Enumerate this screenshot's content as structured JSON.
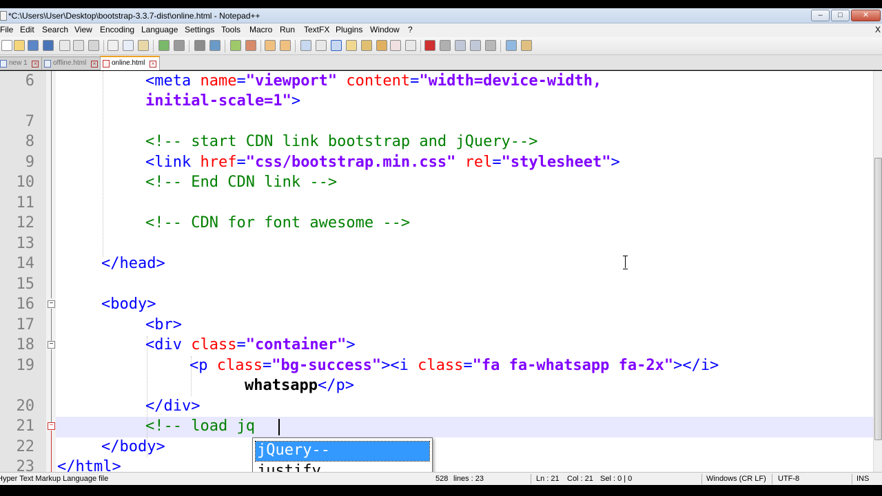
{
  "window": {
    "title": "*C:\\Users\\User\\Desktop\\bootstrap-3.3.7-dist\\online.html - Notepad++",
    "buttons": [
      "–",
      "□",
      "✕"
    ]
  },
  "menubar": {
    "items": [
      "File",
      "Edit",
      "Search",
      "View",
      "Encoding",
      "Language",
      "Settings",
      "Tools",
      "Macro",
      "Run",
      "TextFX",
      "Plugins",
      "Window",
      "?"
    ],
    "close_label": "X"
  },
  "tabs": [
    {
      "label": "new 1",
      "active": false
    },
    {
      "label": "offline.html",
      "active": false
    },
    {
      "label": "online.html",
      "active": true
    }
  ],
  "editor": {
    "line_numbers": [
      "6",
      "7",
      "8",
      "9",
      "10",
      "11",
      "12",
      "13",
      "14",
      "15",
      "16",
      "17",
      "18",
      "19",
      "20",
      "21",
      "22",
      "23"
    ],
    "lines": [
      [
        "<meta",
        " name",
        "=",
        "\"viewport\"",
        " content",
        "=",
        "\"width=device-width,"
      ],
      [
        "initial-scale=1\"",
        ">"
      ],
      [
        "<!-- start CDN link bootstrap and jQuery-->"
      ],
      [
        "<link",
        " href",
        "=",
        "\"css/bootstrap.min.css\"",
        " rel",
        "=",
        "\"stylesheet\"",
        ">"
      ],
      [
        "<!-- End CDN link -->"
      ],
      [
        "<!-- CDN for font awesome -->"
      ],
      [
        "</head>"
      ],
      [
        "<body>"
      ],
      [
        "<br>"
      ],
      [
        "<div",
        " class",
        "=",
        "\"container\"",
        ">"
      ],
      [
        "<p",
        " class",
        "=",
        "\"bg-success\"",
        "><i",
        " class",
        "=",
        "\"fa fa-whatsapp fa-2x\"",
        "></i>"
      ],
      [
        "whatsapp",
        "</p>"
      ],
      [
        "</div>"
      ],
      [
        "<!-- load jq"
      ],
      [
        "</body>"
      ],
      [
        "</html>"
      ]
    ]
  },
  "autocomplete": {
    "items": [
      "jQuery--",
      "justify"
    ],
    "selected_index": 0
  },
  "statusbar": {
    "file_type": "Hyper Text Markup Language file",
    "length": "528",
    "lines": "lines : 23",
    "ln": "Ln : 21",
    "col": "Col : 21",
    "sel": "Sel : 0 | 0",
    "eol": "Windows (CR LF)",
    "encoding": "UTF-8",
    "mode": "INS"
  },
  "colors": {
    "tag": "#0000ff",
    "attribute": "#ff0000",
    "value": "#8000ff",
    "comment": "#008000",
    "current_line": "#e8e8ff",
    "autocomplete_selection": "#3399ff"
  }
}
